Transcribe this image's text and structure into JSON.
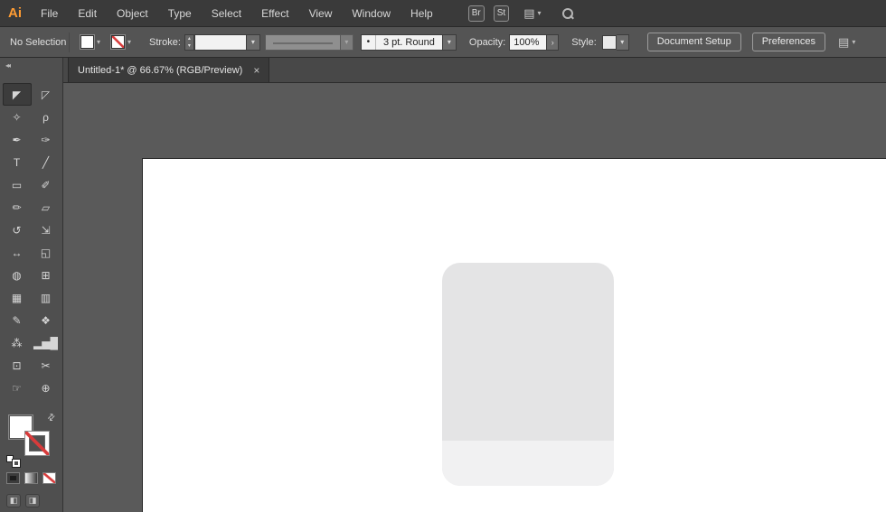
{
  "colors": {
    "logo_orange": "#ff9c33",
    "none_red": "#d83b3b",
    "artboard_white": "#ffffff",
    "shape_body": "#e4e4e5",
    "shape_footer": "#f1f1f2"
  },
  "glyphs": {
    "chevron_down": "▾",
    "step_up": "▴",
    "step_down": "▾",
    "popout": "›",
    "close": "×",
    "collapse": "◂◂",
    "swap": "⇄",
    "dot": "•",
    "panel": "▤"
  },
  "menubar": {
    "logo": "Ai",
    "items": [
      "File",
      "Edit",
      "Object",
      "Type",
      "Select",
      "Effect",
      "View",
      "Window",
      "Help"
    ],
    "bridge_badge": "Br",
    "stock_badge": "St",
    "workspace_icon": "▤"
  },
  "controlbar": {
    "selection_status": "No Selection",
    "stroke_label": "Stroke:",
    "brush_value": "3 pt. Round",
    "opacity_label": "Opacity:",
    "opacity_value": "100%",
    "style_label": "Style:",
    "document_setup_label": "Document Setup",
    "preferences_label": "Preferences"
  },
  "tabbar": {
    "title": "Untitled-1* @ 66.67% (RGB/Preview)"
  },
  "toolbar": {
    "tools": [
      {
        "name": "selection-tool",
        "glyph": "◤",
        "selected": true
      },
      {
        "name": "direct-selection-tool",
        "glyph": "◸",
        "selected": false
      },
      {
        "name": "magic-wand-tool",
        "glyph": "✧",
        "selected": false
      },
      {
        "name": "lasso-tool",
        "glyph": "ρ",
        "selected": false
      },
      {
        "name": "pen-tool",
        "glyph": "✒",
        "selected": false
      },
      {
        "name": "curvature-tool",
        "glyph": "✑",
        "selected": false
      },
      {
        "name": "type-tool",
        "glyph": "T",
        "selected": false
      },
      {
        "name": "line-segment-tool",
        "glyph": "╱",
        "selected": false
      },
      {
        "name": "rectangle-tool",
        "glyph": "▭",
        "selected": false
      },
      {
        "name": "paintbrush-tool",
        "glyph": "✐",
        "selected": false
      },
      {
        "name": "pencil-tool",
        "glyph": "✏",
        "selected": false
      },
      {
        "name": "eraser-tool",
        "glyph": "▱",
        "selected": false
      },
      {
        "name": "rotate-tool",
        "glyph": "↺",
        "selected": false
      },
      {
        "name": "scale-tool",
        "glyph": "⇲",
        "selected": false
      },
      {
        "name": "width-tool",
        "glyph": "↔",
        "selected": false
      },
      {
        "name": "free-transform-tool",
        "glyph": "◱",
        "selected": false
      },
      {
        "name": "shape-builder-tool",
        "glyph": "◍",
        "selected": false
      },
      {
        "name": "perspective-grid-tool",
        "glyph": "⊞",
        "selected": false
      },
      {
        "name": "mesh-tool",
        "glyph": "▦",
        "selected": false
      },
      {
        "name": "gradient-tool",
        "glyph": "▥",
        "selected": false
      },
      {
        "name": "eyedropper-tool",
        "glyph": "✎",
        "selected": false
      },
      {
        "name": "blend-tool",
        "glyph": "❖",
        "selected": false
      },
      {
        "name": "symbol-sprayer-tool",
        "glyph": "⁂",
        "selected": false
      },
      {
        "name": "column-graph-tool",
        "glyph": "▂▅█",
        "selected": false
      },
      {
        "name": "artboard-tool",
        "glyph": "⊡",
        "selected": false
      },
      {
        "name": "slice-tool",
        "glyph": "✂",
        "selected": false
      },
      {
        "name": "hand-tool",
        "glyph": "☞",
        "selected": false
      },
      {
        "name": "zoom-tool",
        "glyph": "⊕",
        "selected": false
      }
    ],
    "screen_buttons": [
      "◧",
      "◨"
    ]
  },
  "canvas": {
    "shape": {
      "body_color": "#e4e4e5",
      "footer_color": "#f1f1f2"
    },
    "artboard_color": "#ffffff"
  }
}
